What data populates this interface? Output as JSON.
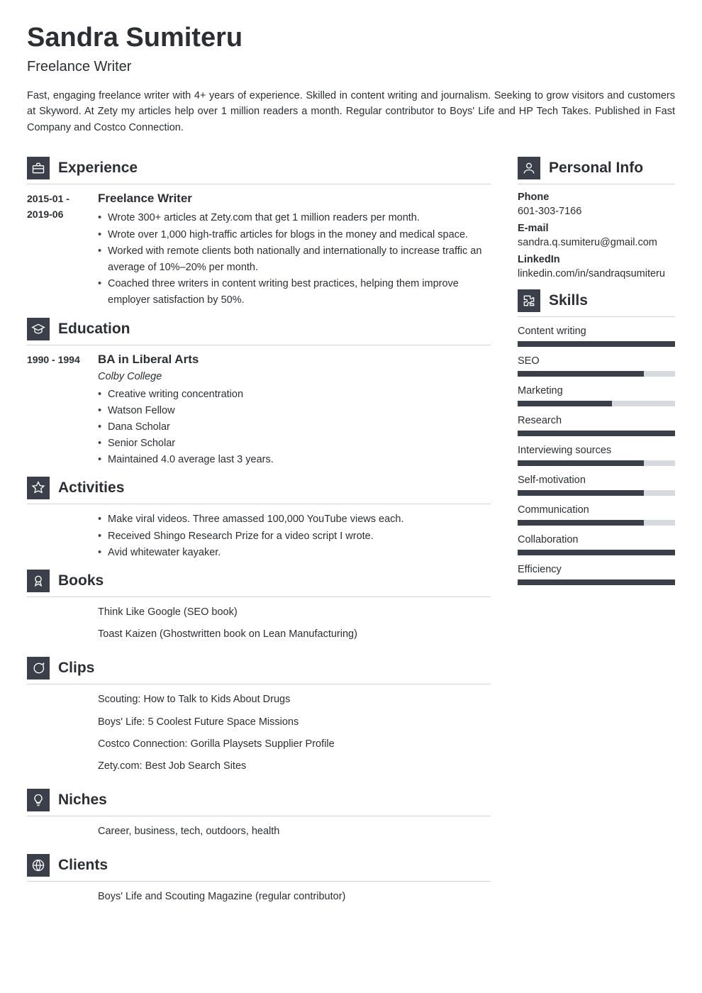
{
  "name": "Sandra Sumiteru",
  "title": "Freelance Writer",
  "summary": "Fast, engaging freelance writer with 4+ years of experience. Skilled in content writing and journalism. Seeking to grow visitors and customers at Skyword. At Zety my articles help over 1 million readers a month. Regular contributor to Boys' Life and HP Tech Takes. Published in Fast Company and Costco Connection.",
  "sections": {
    "experience": {
      "heading": "Experience",
      "items": [
        {
          "dates": "2015-01 - 2019-06",
          "role": "Freelance Writer",
          "bullets": [
            "Wrote 300+ articles at Zety.com that get 1 million readers per month.",
            "Wrote over 1,000 high-traffic articles for blogs in the money and medical space.",
            "Worked with remote clients both nationally and internationally to increase traffic an average of 10%–20% per month.",
            "Coached three writers in content writing best practices, helping them improve employer satisfaction by 50%."
          ]
        }
      ]
    },
    "education": {
      "heading": "Education",
      "items": [
        {
          "dates": "1990 - 1994",
          "role": "BA in Liberal Arts",
          "institution": "Colby College",
          "bullets": [
            "Creative writing concentration",
            "Watson Fellow",
            "Dana Scholar",
            "Senior Scholar",
            "Maintained 4.0 average last 3 years."
          ]
        }
      ]
    },
    "activities": {
      "heading": "Activities",
      "bullets": [
        "Make viral videos. Three amassed 100,000 YouTube views each.",
        "Received Shingo Research Prize for a video script I wrote.",
        "Avid whitewater kayaker."
      ]
    },
    "books": {
      "heading": "Books",
      "lines": [
        "Think Like Google (SEO book)",
        "Toast Kaizen (Ghostwritten book on Lean Manufacturing)"
      ]
    },
    "clips": {
      "heading": "Clips",
      "lines": [
        "Scouting: How to Talk to Kids About Drugs",
        "Boys' Life: 5 Coolest Future Space Missions",
        "Costco Connection: Gorilla Playsets Supplier Profile",
        "Zety.com: Best Job Search Sites"
      ]
    },
    "niches": {
      "heading": "Niches",
      "lines": [
        "Career, business, tech, outdoors, health"
      ]
    },
    "clients": {
      "heading": "Clients",
      "lines": [
        "Boys' Life and Scouting Magazine (regular contributor)"
      ]
    }
  },
  "sidebar": {
    "personal": {
      "heading": "Personal Info",
      "fields": [
        {
          "label": "Phone",
          "value": "601-303-7166"
        },
        {
          "label": "E-mail",
          "value": "sandra.q.sumiteru@gmail.com"
        },
        {
          "label": "LinkedIn",
          "value": "linkedin.com/in/sandraqsumiteru"
        }
      ]
    },
    "skills": {
      "heading": "Skills",
      "items": [
        {
          "label": "Content writing",
          "pct": 100
        },
        {
          "label": "SEO",
          "pct": 80
        },
        {
          "label": "Marketing",
          "pct": 60
        },
        {
          "label": "Research",
          "pct": 100
        },
        {
          "label": "Interviewing sources",
          "pct": 80
        },
        {
          "label": "Self-motivation",
          "pct": 80
        },
        {
          "label": "Communication",
          "pct": 80
        },
        {
          "label": "Collaboration",
          "pct": 100
        },
        {
          "label": "Efficiency",
          "pct": 100
        }
      ]
    }
  }
}
